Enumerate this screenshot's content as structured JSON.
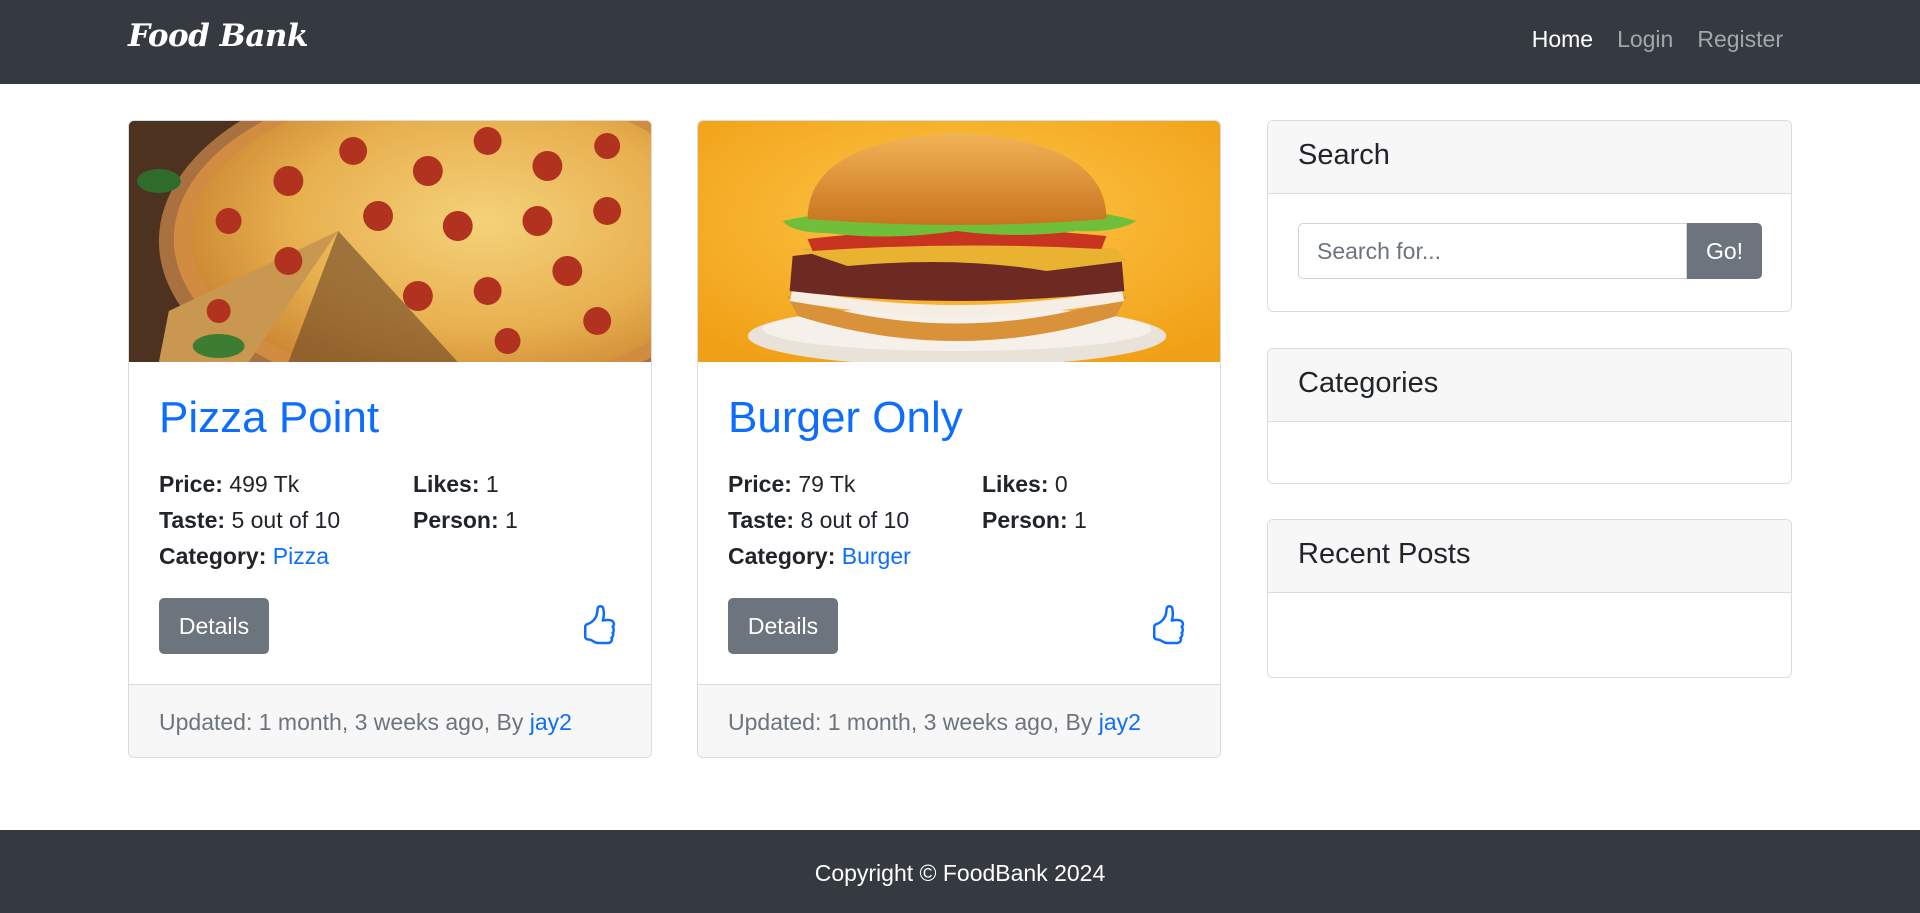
{
  "navbar": {
    "brand": "Food Bank",
    "links": [
      "Home",
      "Login",
      "Register"
    ]
  },
  "posts": [
    {
      "image": "pizza-photo",
      "title": "Pizza Point",
      "price_label": "Price:",
      "price": "499 Tk",
      "likes_label": "Likes:",
      "likes": "1",
      "taste_label": "Taste:",
      "taste": "5 out of 10",
      "person_label": "Person:",
      "person": "1",
      "category_label": "Category:",
      "category": "Pizza",
      "details_label": "Details",
      "like_icon": "thumbs-up-icon",
      "updated": "Updated: 1 month, 3 weeks ago, By ",
      "author": "jay2"
    },
    {
      "image": "burger-photo",
      "title": "Burger Only",
      "price_label": "Price:",
      "price": "79 Tk",
      "likes_label": "Likes:",
      "likes": "0",
      "taste_label": "Taste:",
      "taste": "8 out of 10",
      "person_label": "Person:",
      "person": "1",
      "category_label": "Category:",
      "category": "Burger",
      "details_label": "Details",
      "like_icon": "thumbs-up-icon",
      "updated": "Updated: 1 month, 3 weeks ago, By ",
      "author": "jay2"
    }
  ],
  "sidebar": {
    "search_title": "Search",
    "search_placeholder": "Search for...",
    "search_value": "",
    "go_label": "Go!",
    "categories_title": "Categories",
    "recent_title": "Recent Posts"
  },
  "footer": {
    "copyright": "Copyright © FoodBank 2024"
  },
  "colors": {
    "navbar": "#343a40",
    "link": "#0d6efd",
    "button": "#6c757d",
    "card_footer": "#f7f7f7"
  }
}
